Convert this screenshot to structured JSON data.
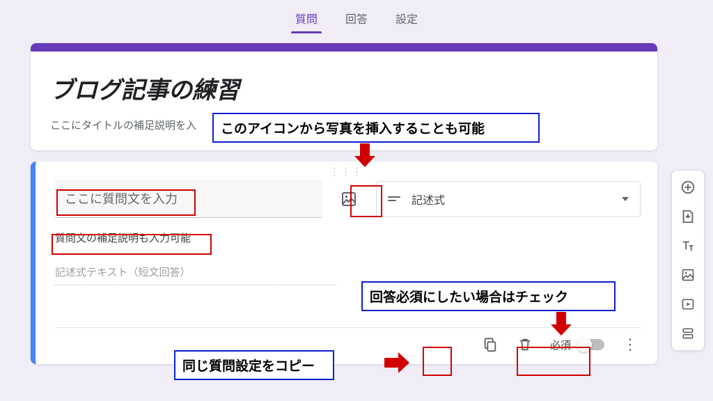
{
  "tabs": {
    "questions": "質問",
    "responses": "回答",
    "settings": "設定"
  },
  "header": {
    "title": "ブログ記事の練習",
    "description_prefix": "ここにタイトルの補足説明を入"
  },
  "question": {
    "title_placeholder": "ここに質問文を入力",
    "description": "質問文の補足説明も入力可能",
    "type_label": "記述式",
    "answer_placeholder": "記述式テキスト（短文回答）",
    "required_label": "必須"
  },
  "annotations": {
    "insert_image": "このアイコンから写真を挿入することも可能",
    "copy_question": "同じ質問設定をコピー",
    "required_check": "回答必須にしたい場合はチェック"
  }
}
